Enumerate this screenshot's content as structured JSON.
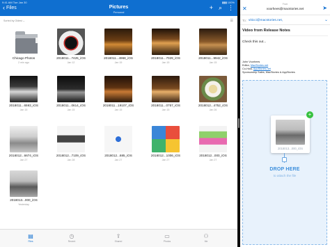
{
  "files": {
    "status": {
      "time": "9:41 AM Tue Jan 30",
      "icons": "▮▮▮ 100%"
    },
    "back_label": "Files",
    "title": "Pictures",
    "subtitle": "Personal",
    "sort_label": "Sorted by Oldest ⌄",
    "tiles": [
      {
        "name": "Chicago Photos",
        "date": "2 min ago"
      },
      {
        "name": "2018011...7425_iOS",
        "date": "Jan 12"
      },
      {
        "name": "2018011...4968_iOS",
        "date": "Jan 15"
      },
      {
        "name": "2018011...7029_iOS",
        "date": "Jan 15"
      },
      {
        "name": "2018011...9942_iOS",
        "date": "Jan 15"
      },
      {
        "name": "2018011...6593_iOS",
        "date": "Jan 15"
      },
      {
        "name": "2018011...0614_iOS",
        "date": "Jan 15"
      },
      {
        "name": "2018011...19107_iOS",
        "date": "Jan 15"
      },
      {
        "name": "2018011...0757_iOS",
        "date": "Jan 15"
      },
      {
        "name": "2018012...4752_iOS",
        "date": "Jan 26"
      },
      {
        "name": "2018012...6674_iOS",
        "date": "Jan 27"
      },
      {
        "name": "2018012...7109_iOS",
        "date": "Jan 28"
      },
      {
        "name": "2018012...685_iOS",
        "date": "Jan 27"
      },
      {
        "name": "2018012...1006_iOS",
        "date": "Jan 27"
      },
      {
        "name": "2018012...000_iOS",
        "date": "Jan 27"
      },
      {
        "name": "2018013...000_iOS",
        "date": "Yesterday"
      }
    ],
    "tabs": [
      {
        "label": "Files",
        "icon": "▤"
      },
      {
        "label": "Recent",
        "icon": "◷"
      },
      {
        "label": "Shared",
        "icon": "⇪"
      },
      {
        "label": "Photos",
        "icon": "▭"
      },
      {
        "label": "Me",
        "icon": "⚇"
      }
    ]
  },
  "compose": {
    "from_label": "From",
    "from": "voorhees@macstories.net",
    "to_label": "To:",
    "to": "viticci@macstories.net,",
    "subject": "Video from Release Notes",
    "body": "Check this out...",
    "signature": {
      "name": "John Voorhees",
      "editor_label": "Editor,",
      "editor_link": "MacStories.net",
      "cohost_label": "Co-Host,",
      "cohost_link": "AppStories.net",
      "sponsorship": "Sponsorship Sales, MacStories & AppStories"
    },
    "drag_caption": "2018013...000_iOS",
    "drop_title": "DROP HERE",
    "drop_subtitle": "to attach the file"
  },
  "colors": {
    "accent": "#0f6fd0",
    "drop_bg": "#e8f2fc",
    "plus_badge": "#37c13f"
  }
}
